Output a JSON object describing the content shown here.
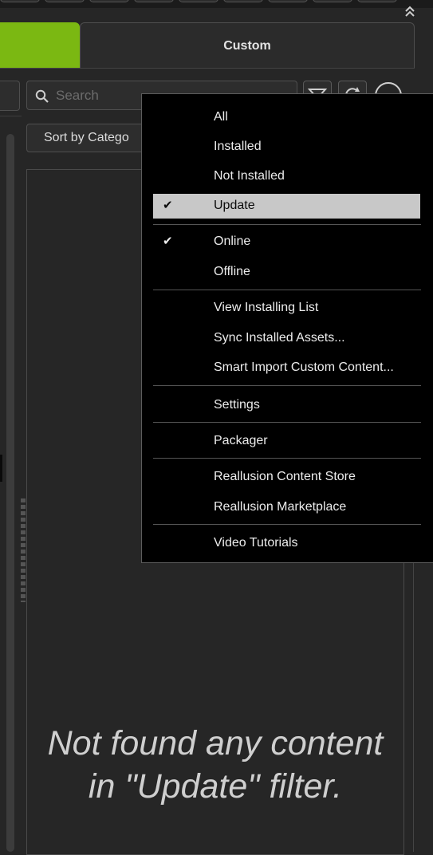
{
  "header": {
    "collapse_icon": "double-chevron-up-icon",
    "tab_active_color": "#7bb812",
    "tab_custom_label": "Custom"
  },
  "toolbar": {
    "search_placeholder": "Search",
    "search_value": "",
    "sort_label": "Sort by Catego",
    "icons": [
      "search-icon",
      "filter-icon",
      "sync-icon",
      "circle-icon"
    ]
  },
  "content": {
    "empty_line1": "Not found any content",
    "empty_line2": "in \"Update\" filter."
  },
  "menu": {
    "items": [
      {
        "label": "All",
        "checked": false
      },
      {
        "label": "Installed",
        "checked": false
      },
      {
        "label": "Not Installed",
        "checked": false
      },
      {
        "label": "Update",
        "checked": true,
        "highlighted": true
      },
      {
        "label": "Online",
        "checked": true
      },
      {
        "label": "Offline",
        "checked": false
      },
      {
        "label": "View Installing List"
      },
      {
        "label": "Sync Installed Assets..."
      },
      {
        "label": "Smart Import Custom Content..."
      },
      {
        "label": "Settings"
      },
      {
        "label": "Packager"
      },
      {
        "label": "Reallusion Content Store"
      },
      {
        "label": "Reallusion Marketplace"
      },
      {
        "label": "Video Tutorials"
      }
    ],
    "check_glyph": "✔"
  }
}
